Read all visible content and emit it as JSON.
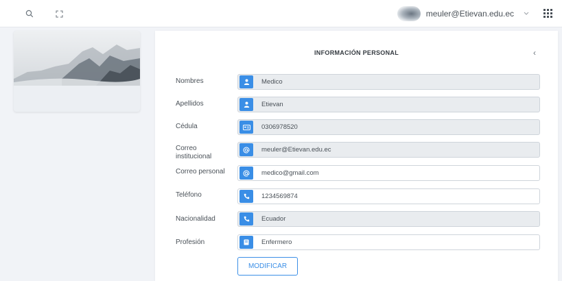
{
  "topbar": {
    "user_email": "meuler@Etievan.edu.ec"
  },
  "panel": {
    "title": "INFORMACIÓN PERSONAL",
    "collapse_glyph": "‹"
  },
  "fields": [
    {
      "label": "Nombres",
      "value": "Medico",
      "icon": "user-icon"
    },
    {
      "label": "Apellidos",
      "value": "Etievan",
      "icon": "user-icon"
    },
    {
      "label": "Cédula",
      "value": "0306978520",
      "icon": "id-card-icon"
    },
    {
      "label": "Correo institucional",
      "value": "meuler@Etievan.edu.ec",
      "icon": "at-icon"
    },
    {
      "label": "Correo personal",
      "value": "medico@gmail.com",
      "icon": "at-icon"
    },
    {
      "label": "Teléfono",
      "value": "1234569874",
      "icon": "phone-icon"
    },
    {
      "label": "Nacionalidad",
      "value": "Ecuador",
      "icon": "phone-icon"
    },
    {
      "label": "Profesión",
      "value": "Enfermero",
      "icon": "book-icon"
    }
  ],
  "actions": {
    "modify_label": "MODIFICAR"
  },
  "colors": {
    "accent": "#3a8ee6",
    "readonly_bg": "#e9ecef",
    "page_bg": "#f1f3f7"
  }
}
